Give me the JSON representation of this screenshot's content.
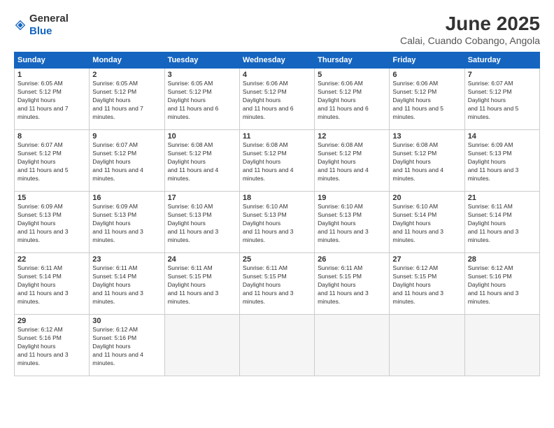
{
  "logo": {
    "general": "General",
    "blue": "Blue"
  },
  "header": {
    "month": "June 2025",
    "location": "Calai, Cuando Cobango, Angola"
  },
  "weekdays": [
    "Sunday",
    "Monday",
    "Tuesday",
    "Wednesday",
    "Thursday",
    "Friday",
    "Saturday"
  ],
  "weeks": [
    [
      {
        "day": "1",
        "sunrise": "6:05 AM",
        "sunset": "5:12 PM",
        "daylight": "11 hours and 7 minutes."
      },
      {
        "day": "2",
        "sunrise": "6:05 AM",
        "sunset": "5:12 PM",
        "daylight": "11 hours and 7 minutes."
      },
      {
        "day": "3",
        "sunrise": "6:05 AM",
        "sunset": "5:12 PM",
        "daylight": "11 hours and 6 minutes."
      },
      {
        "day": "4",
        "sunrise": "6:06 AM",
        "sunset": "5:12 PM",
        "daylight": "11 hours and 6 minutes."
      },
      {
        "day": "5",
        "sunrise": "6:06 AM",
        "sunset": "5:12 PM",
        "daylight": "11 hours and 6 minutes."
      },
      {
        "day": "6",
        "sunrise": "6:06 AM",
        "sunset": "5:12 PM",
        "daylight": "11 hours and 5 minutes."
      },
      {
        "day": "7",
        "sunrise": "6:07 AM",
        "sunset": "5:12 PM",
        "daylight": "11 hours and 5 minutes."
      }
    ],
    [
      {
        "day": "8",
        "sunrise": "6:07 AM",
        "sunset": "5:12 PM",
        "daylight": "11 hours and 5 minutes."
      },
      {
        "day": "9",
        "sunrise": "6:07 AM",
        "sunset": "5:12 PM",
        "daylight": "11 hours and 4 minutes."
      },
      {
        "day": "10",
        "sunrise": "6:08 AM",
        "sunset": "5:12 PM",
        "daylight": "11 hours and 4 minutes."
      },
      {
        "day": "11",
        "sunrise": "6:08 AM",
        "sunset": "5:12 PM",
        "daylight": "11 hours and 4 minutes."
      },
      {
        "day": "12",
        "sunrise": "6:08 AM",
        "sunset": "5:12 PM",
        "daylight": "11 hours and 4 minutes."
      },
      {
        "day": "13",
        "sunrise": "6:08 AM",
        "sunset": "5:12 PM",
        "daylight": "11 hours and 4 minutes."
      },
      {
        "day": "14",
        "sunrise": "6:09 AM",
        "sunset": "5:13 PM",
        "daylight": "11 hours and 3 minutes."
      }
    ],
    [
      {
        "day": "15",
        "sunrise": "6:09 AM",
        "sunset": "5:13 PM",
        "daylight": "11 hours and 3 minutes."
      },
      {
        "day": "16",
        "sunrise": "6:09 AM",
        "sunset": "5:13 PM",
        "daylight": "11 hours and 3 minutes."
      },
      {
        "day": "17",
        "sunrise": "6:10 AM",
        "sunset": "5:13 PM",
        "daylight": "11 hours and 3 minutes."
      },
      {
        "day": "18",
        "sunrise": "6:10 AM",
        "sunset": "5:13 PM",
        "daylight": "11 hours and 3 minutes."
      },
      {
        "day": "19",
        "sunrise": "6:10 AM",
        "sunset": "5:13 PM",
        "daylight": "11 hours and 3 minutes."
      },
      {
        "day": "20",
        "sunrise": "6:10 AM",
        "sunset": "5:14 PM",
        "daylight": "11 hours and 3 minutes."
      },
      {
        "day": "21",
        "sunrise": "6:11 AM",
        "sunset": "5:14 PM",
        "daylight": "11 hours and 3 minutes."
      }
    ],
    [
      {
        "day": "22",
        "sunrise": "6:11 AM",
        "sunset": "5:14 PM",
        "daylight": "11 hours and 3 minutes."
      },
      {
        "day": "23",
        "sunrise": "6:11 AM",
        "sunset": "5:14 PM",
        "daylight": "11 hours and 3 minutes."
      },
      {
        "day": "24",
        "sunrise": "6:11 AM",
        "sunset": "5:15 PM",
        "daylight": "11 hours and 3 minutes."
      },
      {
        "day": "25",
        "sunrise": "6:11 AM",
        "sunset": "5:15 PM",
        "daylight": "11 hours and 3 minutes."
      },
      {
        "day": "26",
        "sunrise": "6:11 AM",
        "sunset": "5:15 PM",
        "daylight": "11 hours and 3 minutes."
      },
      {
        "day": "27",
        "sunrise": "6:12 AM",
        "sunset": "5:15 PM",
        "daylight": "11 hours and 3 minutes."
      },
      {
        "day": "28",
        "sunrise": "6:12 AM",
        "sunset": "5:16 PM",
        "daylight": "11 hours and 3 minutes."
      }
    ],
    [
      {
        "day": "29",
        "sunrise": "6:12 AM",
        "sunset": "5:16 PM",
        "daylight": "11 hours and 3 minutes."
      },
      {
        "day": "30",
        "sunrise": "6:12 AM",
        "sunset": "5:16 PM",
        "daylight": "11 hours and 4 minutes."
      },
      null,
      null,
      null,
      null,
      null
    ]
  ]
}
